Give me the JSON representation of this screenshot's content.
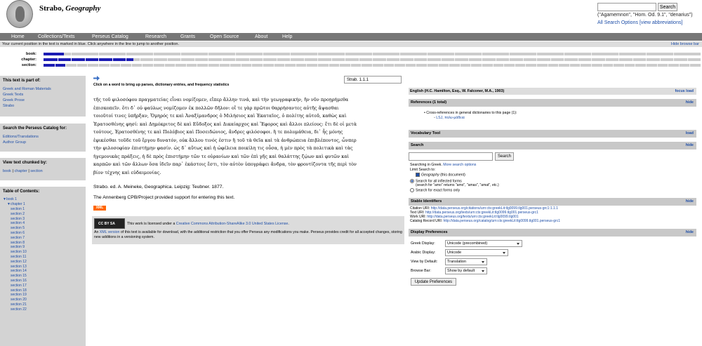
{
  "header": {
    "title_plain": "Strabo, ",
    "title_italic": "Geography",
    "search_button": "Search",
    "search_hint": "(\"Agamemnon\", \"Hom. Od. 9.1\", \"denarius\")",
    "all_search": "All Search Options",
    "view_abbrev": "[view abbreviations]"
  },
  "nav": [
    "Home",
    "Collections/Texts",
    "Perseus Catalog",
    "Research",
    "Grants",
    "Open Source",
    "About",
    "Help"
  ],
  "position": {
    "message": "Your current position in the text is marked in blue. Click anywhere in the line to jump to another position.",
    "hide": "Hide browse bar",
    "labels": {
      "book": "book:",
      "chapter": "chapter:",
      "section": "section:"
    },
    "book_fraction": 0.031,
    "chapter_fraction": 0.137,
    "section_fraction": 0.033
  },
  "sidebar": {
    "part_of_title": "This text is part of:",
    "part_of": [
      "Greek and Roman Materials",
      "Greek Texts",
      "Greek Prose",
      "Strabo"
    ],
    "catalog_title": "Search the Perseus Catalog for:",
    "catalog": [
      "Editions/Translations",
      "Author Group"
    ],
    "chunk_title": "View text chunked by:",
    "chunk_book": "book",
    "chunk_chapter": "chapter",
    "chunk_section": "section",
    "sep": " | ",
    "toc_title": "Table of Contents:",
    "toc_book": "book 1",
    "toc_chapter": "chapter 1",
    "toc_sections": [
      "section 1",
      "section 2",
      "section 3",
      "section 4",
      "section 5",
      "section 6",
      "section 7",
      "section 8",
      "section 9",
      "section 10",
      "section 11",
      "section 12",
      "section 13",
      "section 14",
      "section 15",
      "section 16",
      "section 17",
      "section 18",
      "section 19",
      "section 20",
      "section 21",
      "section 22"
    ]
  },
  "main": {
    "click_hint": "Click on a word to bring up parses, dictionary entries, and frequency statistics",
    "location": "Strab. 1.1.1",
    "greek_lines": [
      "τῆς τοῦ φιλοσόφου πραγματείας εἶναι νομίζομεν, εἴπερ ἄλλην τινά, καὶ τὴν γεωγραφικήν, ἣν νῦν προῃρήμεθα",
      "ἐπισκοπεῖν. ὅτι δ᾽ οὐ φαύλως νομίζομεν ἐκ πολλῶν δῆλον: οἵ τε γὰρ πρῶτοι θαρρήσαντες αὐτῆς ἅψασθαι",
      "τοιοῦτοί τινες ὑπῆρξαν, Ὅμηρός τε καὶ Ἀναξίμανδρος ὁ Μιλήσιος καὶ Ἑκαταῖος, ὁ πολίτης αὐτοῦ, καθὼς καὶ",
      "Ἐρατοσθένης φησί: καὶ Δημόκριτος δὲ καὶ Εὔδοξος καὶ Δικαίαρχος καὶ Ἔφορος καὶ ἄλλοι πλείους: ἔτι δὲ οἱ μετὰ",
      "τούτους, Ἐρατοσθένης τε καὶ Πολύβιος καὶ Ποσειδώνιος, ἄνδρες φιλόσοφοι. ἥ τε πολυμάθεια, δι᾽ ἧς μόνης",
      "ἐφικέσθαι τοῦδε τοῦ ἔργου δυνατόν, οὐκ ἄλλου τινός ἐστιν ἢ τοῦ τὰ θεῖα καὶ τὰ ἀνθρώπεια ἐπιβλέποντος, ὧνπερ",
      "τὴν φιλοσοφίαν ἐπιστήμην φασίν. ὡς δ᾽ αὕτως καὶ ἡ ὠφέλεια ποικίλη τις οὖσα, ἡ μὲν πρὸς τὰ πολιτικὰ καὶ τὰς",
      "ἡγεμονικὰς πράξεις, ἡ δὲ πρὸς ἐπιστήμην τῶν τε οὐρανίων καὶ τῶν ἐπὶ γῆς καὶ θαλάττης ζῴων καὶ φυτῶν καὶ",
      "καρπῶν καὶ τῶν ἄλλων ὅσα ἰδεῖν παρ᾽ ἑκάστοις ἔστι, τὸν αὐτὸν ὑπογράφει ἄνδρα, τὸν φροντίζοντα τῆς περὶ τὸν",
      "βίον τέχνης καὶ εὐδαιμονίας."
    ],
    "source": "Strabo. ed. A. Meineke, Geographica. Leipzig: Teubner. 1877.",
    "annenberg": "The Annenberg CPB/Project provided support for entering this text.",
    "xml": "XML",
    "cc_label": "CC BY SA",
    "license_pre": "This work is licensed under a ",
    "license_link": "Creative Commons Attribution-ShareAlike 3.0 United States License",
    "license_post": ".",
    "xml_pre": "An ",
    "xml_link": "XML version",
    "xml_post": " of this text is available for download, with the additional restriction that you offer Perseus any modifications you make. Perseus provides credit for all accepted changes, storing new additions in a versioning system."
  },
  "right": {
    "english_title": "English (H.C. Hamilton, Esq., W. Falconer, M.A., 1903)",
    "focus_load": "focus load",
    "references_title": "References (1 total)",
    "hide": "hide",
    "load": "load",
    "ref_text": "Cross-references in general dictionaries to this page (1):",
    "ref_link": "LSJ, πολυ-μάθεια",
    "vocab_title": "Vocabulary Tool",
    "search_title": "Search",
    "search_button": "Search",
    "searching_in": "Searching in Greek. ",
    "more_options": "More search options",
    "limit": "Limit Search to:",
    "geo_italic": "Geography",
    "geo_rest": " (this document)",
    "opt_inflected": "Search for all inflected forms",
    "opt_inflected_hint": "(search for \"amo\" returns \"amo\", \"amas\", \"amat\", etc.)",
    "opt_exact": "Search for exact forms only",
    "stable_title": "Stable Identifiers",
    "ids": [
      {
        "label": "Citation URI: ",
        "value": "http://data.perseus.org/citations/urn:cts:greekLit:tlg0099.tlg001.perseus-grc1:1.1.1"
      },
      {
        "label": "Text URI: ",
        "value": "http://data.perseus.org/texts/urn:cts:greekLit:tlg0099.tlg001.perseus-grc1"
      },
      {
        "label": "Work URI: ",
        "value": "http://data.perseus.org/texts/urn:cts:greekLit:tlg0099.tlg001"
      },
      {
        "label": "Catalog Record URI: ",
        "value": "http://data.perseus.org/catalog/urn:cts:greekLit:tlg0099.tlg001.perseus-grc1"
      }
    ],
    "display_title": "Display Preferences",
    "prefs": [
      {
        "label": "Greek Display:",
        "value": "Unicode (precombined)"
      },
      {
        "label": "Arabic Display:",
        "value": "Unicode"
      },
      {
        "label": "View by Default:",
        "value": "Translation"
      },
      {
        "label": "Browse Bar:",
        "value": "Show by default"
      }
    ],
    "update": "Update Preferences"
  }
}
